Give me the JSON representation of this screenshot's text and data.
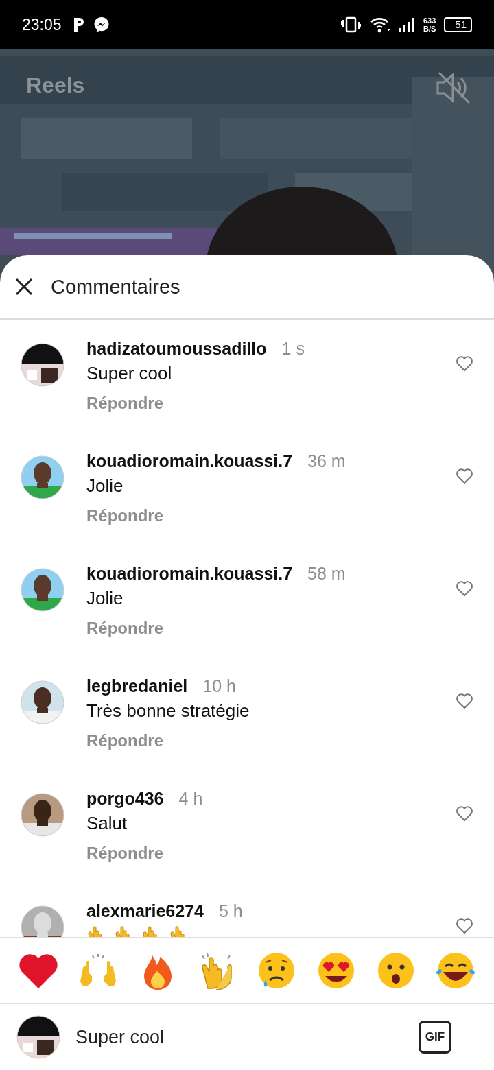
{
  "status_bar": {
    "time": "23:05",
    "speed_value": "633",
    "speed_unit": "B/S",
    "battery": "51"
  },
  "video": {
    "title": "Reels",
    "muted": true
  },
  "comments_sheet": {
    "title": "Commentaires",
    "comments": [
      {
        "kind": "text",
        "username": "hadizatoumoussadillo",
        "time": "1 s",
        "text": "Super cool",
        "reply_label": "Répondre",
        "liked": false
      },
      {
        "kind": "text",
        "username": "kouadioromain.kouassi.7",
        "time": "36 m",
        "text": "Jolie",
        "reply_label": "Répondre",
        "liked": false
      },
      {
        "kind": "text",
        "username": "kouadioromain.kouassi.7",
        "time": "58 m",
        "text": "Jolie",
        "reply_label": "Répondre",
        "liked": false
      },
      {
        "kind": "text",
        "username": "legbredaniel",
        "time": "10 h",
        "text": "Très bonne stratégie",
        "reply_label": "Répondre",
        "liked": false
      },
      {
        "kind": "text",
        "username": "porgo436",
        "time": "4 h",
        "text": "Salut",
        "reply_label": "Répondre",
        "liked": false
      },
      {
        "kind": "emoji",
        "username": "alexmarie6274",
        "time": "5 h",
        "liked": false
      }
    ]
  },
  "composer": {
    "value": "Super cool",
    "gif_label": "GIF"
  }
}
